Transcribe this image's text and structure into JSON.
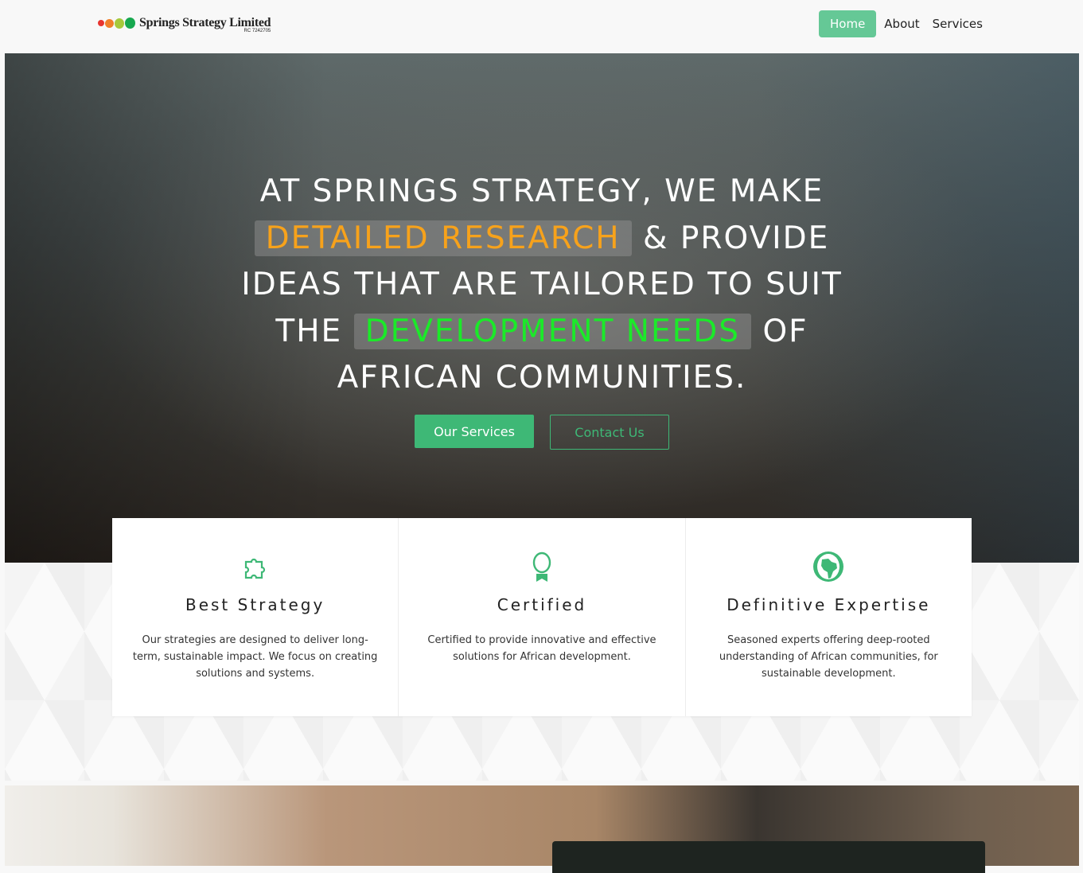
{
  "nav": {
    "brand": "Springs Strategy Limited",
    "rc": "RC 7242705",
    "logo_colors": [
      "#e8342f",
      "#f07f2a",
      "#a6c93b",
      "#17a84f"
    ],
    "items": [
      {
        "label": "Home",
        "active": true
      },
      {
        "label": "About"
      },
      {
        "label": "Services"
      }
    ]
  },
  "hero": {
    "line1": "AT SPRINGS STRATEGY, WE MAKE",
    "highlight1": "DETAILED RESEARCH",
    "line2b": " & PROVIDE",
    "line3": "IDEAS THAT ARE TAILORED TO SUIT",
    "line4a": "THE ",
    "highlight2": "DEVELOPMENT NEEDS",
    "line4b": " OF",
    "line5": "AFRICAN COMMUNITIES.",
    "primary_button": "Our Services",
    "secondary_button": "Contact Us"
  },
  "features": [
    {
      "icon": "puzzle-icon",
      "title": "Best Strategy",
      "text": "Our strategies are designed to deliver long-term, sustainable impact. We focus on creating solutions and systems."
    },
    {
      "icon": "award-icon",
      "title": "Certified",
      "text": "Certified to provide innovative and effective solutions for African development."
    },
    {
      "icon": "globe-africa-icon",
      "title": "Definitive Expertise",
      "text": "Seasoned experts offering deep-rooted understanding of African communities, for sustainable development."
    }
  ],
  "colors": {
    "accent": "#3eb876",
    "orange": "#f7a21b",
    "green_highlight": "#1bea29"
  }
}
